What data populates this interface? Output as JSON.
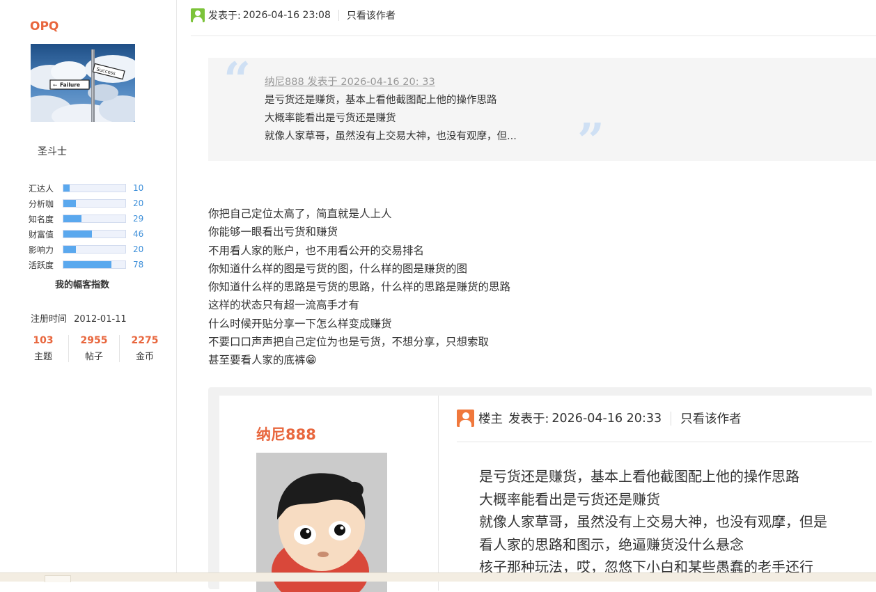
{
  "sidebar": {
    "username": "OPQ",
    "rank": "圣斗士",
    "stats": [
      {
        "label": "汇达人",
        "value": "10",
        "fraction": 0.1
      },
      {
        "label": "分析咖",
        "value": "20",
        "fraction": 0.2
      },
      {
        "label": "知名度",
        "value": "29",
        "fraction": 0.29
      },
      {
        "label": "财富值",
        "value": "46",
        "fraction": 0.46
      },
      {
        "label": "影响力",
        "value": "20",
        "fraction": 0.2
      },
      {
        "label": "活跃度",
        "value": "78",
        "fraction": 0.78
      }
    ],
    "stats_title": "我的幅客指数",
    "register_label": "注册时间",
    "register_date": "2012-01-11",
    "counts": [
      {
        "num": "103",
        "label": "主题"
      },
      {
        "num": "2955",
        "label": "帖子"
      },
      {
        "num": "2275",
        "label": "金币"
      }
    ],
    "avatar_signs": {
      "success": "Success",
      "failure": "Failure"
    }
  },
  "post": {
    "posted_label": "发表于:",
    "timestamp": "2026-04-16 23:08",
    "only_author": "只看该作者",
    "icon_color": "#7cc33a",
    "quote": {
      "meta": "纳尼888 发表于 2026-04-16 20: 33",
      "lines": [
        "是亏货还是赚货，基本上看他截图配上他的操作思路",
        "大概率能看出是亏货还是赚货",
        "就像人家草哥，虽然没有上交易大神，也没有观摩，但..."
      ]
    },
    "body": [
      "你把自己定位太高了，简直就是人上人",
      "你能够一眼看出亏货和赚货",
      "不用看人家的账户，也不用看公开的交易排名",
      "你知道什么样的图是亏货的图，什么样的图是赚货的图",
      "你知道什么样的思路是亏货的思路，什么样的思路是赚货的思路",
      "这样的状态只有超一流高手才有",
      "什么时候开贴分享一下怎么样变成赚货",
      "不要口口声声把自己定位为也是亏货，不想分享，只想索取",
      "甚至要看人家的底裤😁"
    ]
  },
  "embedded": {
    "username": "纳尼888",
    "role": "楼主",
    "posted_label": "发表于:",
    "timestamp": "2026-04-16 20:33",
    "only_author": "只看该作者",
    "icon_color": "#f0783c",
    "lines": [
      "是亏货还是赚货，基本上看他截图配上他的操作思路",
      "大概率能看出是亏货还是赚货",
      "就像人家草哥，虽然没有上交易大神，也没有观摩，但是",
      "看人家的思路和图示，绝逼赚货没什么悬念",
      "核子那种玩法，哎，忽悠下小白和某些愚蠢的老手还行"
    ]
  },
  "colors": {
    "accent": "#e8663d",
    "stat_bar": "#5aa8ee",
    "stat_value": "#3d8fd9",
    "quote_bg": "#f5f5f5",
    "quote_mark": "#cfe0f4"
  }
}
